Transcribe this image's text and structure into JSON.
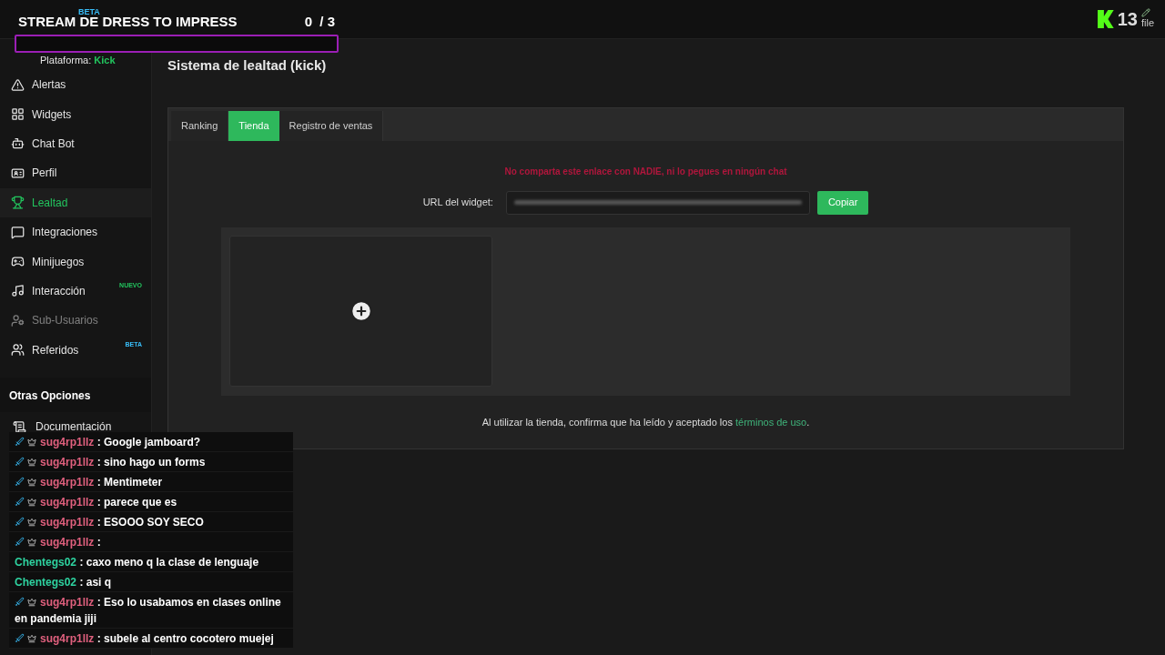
{
  "stream_overlay": {
    "title": "STREAM DE DRESS TO IMPRESS",
    "progress": "0  / 3",
    "level": 0
  },
  "top_bar": {
    "counter": "13",
    "profile_label": "file"
  },
  "sidebar": {
    "logo_badge": "BETA",
    "platform_label": "Plataforma:",
    "platform": "Kick",
    "items": [
      {
        "label": "Alertas",
        "selected": false,
        "disabled": false
      },
      {
        "label": "Widgets",
        "selected": false,
        "disabled": false
      },
      {
        "label": "Chat Bot",
        "selected": false,
        "disabled": false
      },
      {
        "label": "Perfil",
        "selected": false,
        "disabled": false
      },
      {
        "label": "Lealtad",
        "selected": true,
        "disabled": false
      },
      {
        "label": "Integraciones",
        "selected": false,
        "disabled": false
      },
      {
        "label": "Minijuegos",
        "selected": false,
        "disabled": false
      },
      {
        "label": "Interacción",
        "selected": false,
        "disabled": false,
        "badge": {
          "text": "NUEVO",
          "kind": "new"
        }
      },
      {
        "label": "Sub-Usuarios",
        "selected": false,
        "disabled": true
      },
      {
        "label": "Referidos",
        "selected": false,
        "disabled": false,
        "badge": {
          "text": "BETA",
          "kind": "beta"
        }
      }
    ],
    "section_title": "Otras Opciones",
    "other_items": [
      {
        "label": "Documentación"
      }
    ]
  },
  "page": {
    "title": "Sistema de lealtad (kick)",
    "tabs": [
      {
        "label": "Ranking",
        "selected": false
      },
      {
        "label": "Tienda",
        "selected": true
      },
      {
        "label": "Registro de ventas",
        "selected": false
      }
    ],
    "warning": "No comparta este enlace con NADIE, ni lo pegues en ningún chat",
    "url_label": "URL del widget:",
    "copy_button": "Copiar",
    "footer_text": "Al utilizar la tienda, confirma que ha leído y aceptado los",
    "footer_link": "términos de uso",
    "footer_end": "."
  },
  "chat": [
    {
      "user": "sug4rp1llz",
      "color": "#e0607e",
      "badges": true,
      "text": ": Google jamboard?"
    },
    {
      "user": "sug4rp1llz",
      "color": "#e0607e",
      "badges": true,
      "text": ": sino hago un forms"
    },
    {
      "user": "sug4rp1llz",
      "color": "#e0607e",
      "badges": true,
      "text": ": Mentimeter"
    },
    {
      "user": "sug4rp1llz",
      "color": "#e0607e",
      "badges": true,
      "text": ": parece que es"
    },
    {
      "user": "sug4rp1llz",
      "color": "#e0607e",
      "badges": true,
      "text": ": ESOOO SOY SECO"
    },
    {
      "user": "sug4rp1llz",
      "color": "#e0607e",
      "badges": true,
      "text": ":"
    },
    {
      "user": "Chentegs02",
      "color": "#2ed3a0",
      "badges": false,
      "text": ": caxo meno q la clase de lenguaje"
    },
    {
      "user": "Chentegs02",
      "color": "#2ed3a0",
      "badges": false,
      "text": ": asi q"
    },
    {
      "user": "sug4rp1llz",
      "color": "#e0607e",
      "badges": true,
      "text": ": Eso lo usabamos en clases online en pandemia jiji"
    },
    {
      "user": "sug4rp1llz",
      "color": "#e0607e",
      "badges": true,
      "text": ": subele al centro cocotero muejej"
    }
  ]
}
